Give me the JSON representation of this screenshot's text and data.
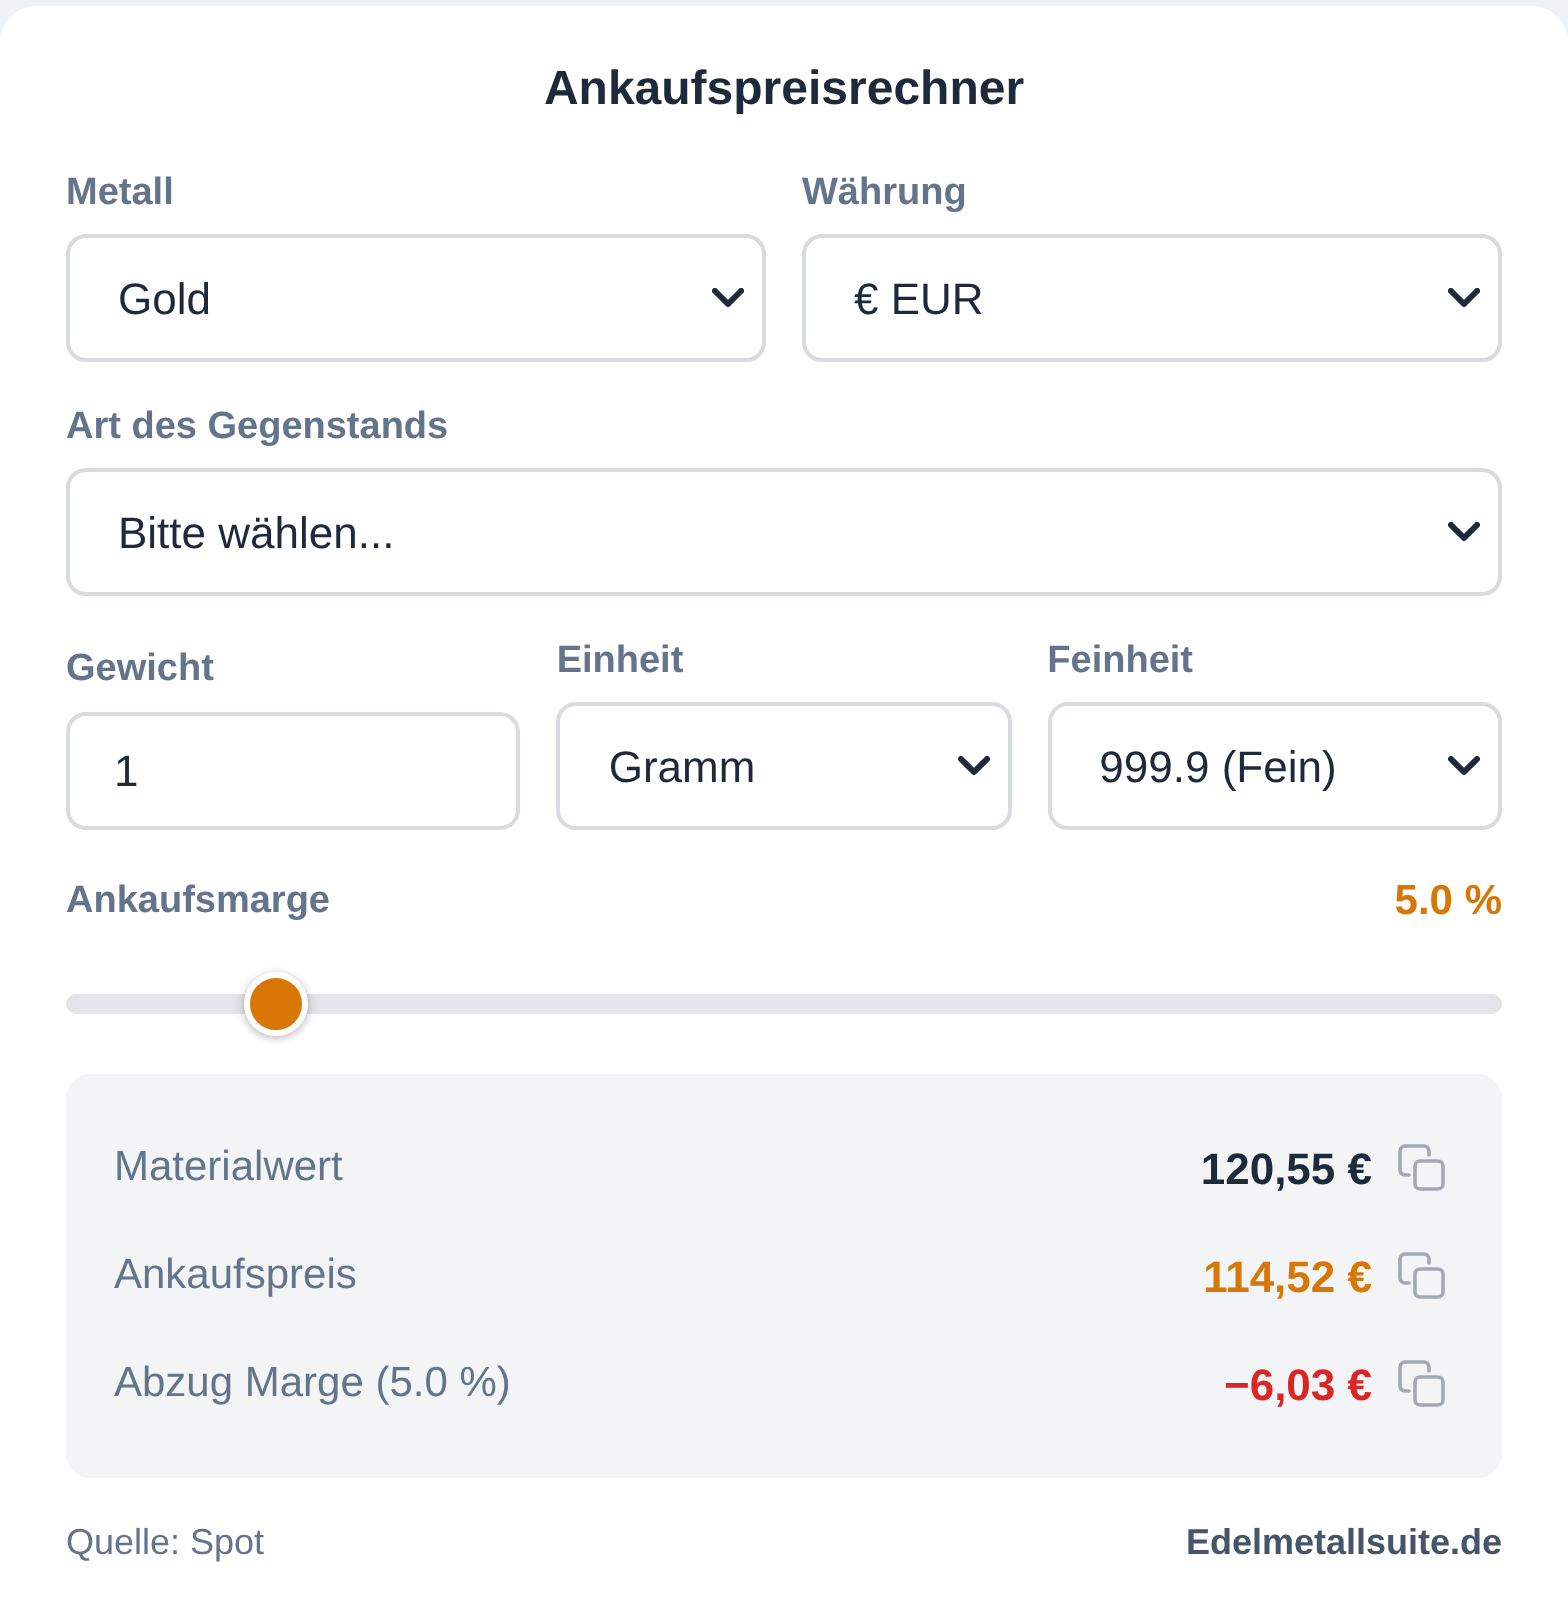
{
  "title": "Ankaufspreisrechner",
  "form_rows": [
    {
      "fields": [
        {
          "kind": "select",
          "label": "Metall",
          "value": "Gold"
        },
        {
          "kind": "select",
          "label": "Währung",
          "value": "€ EUR"
        }
      ]
    },
    {
      "fields": [
        {
          "kind": "select",
          "label": "Art des Gegenstands",
          "value": "Bitte wählen..."
        }
      ]
    },
    {
      "fields": [
        {
          "kind": "input",
          "label": "Gewicht",
          "value": "1"
        },
        {
          "kind": "select",
          "label": "Einheit",
          "value": "Gramm"
        },
        {
          "kind": "select",
          "label": "Feinheit",
          "value": "999.9 (Fein)"
        }
      ]
    }
  ],
  "margin": {
    "label": "Ankaufsmarge",
    "reading": "5.0 %",
    "level": 0.13
  },
  "results": [
    {
      "label": "Materialwert",
      "value": "120,55 €",
      "color": "#1e293b"
    },
    {
      "label": "Ankaufspreis",
      "value": "114,52 €",
      "color": "#d97706"
    },
    {
      "label": "Abzug Marge (5.0 %)",
      "value": "−6,03 €",
      "color": "#dc2626"
    }
  ],
  "footer": {
    "source": "Quelle: Spot",
    "link": "Edelmetallsuite.de"
  }
}
